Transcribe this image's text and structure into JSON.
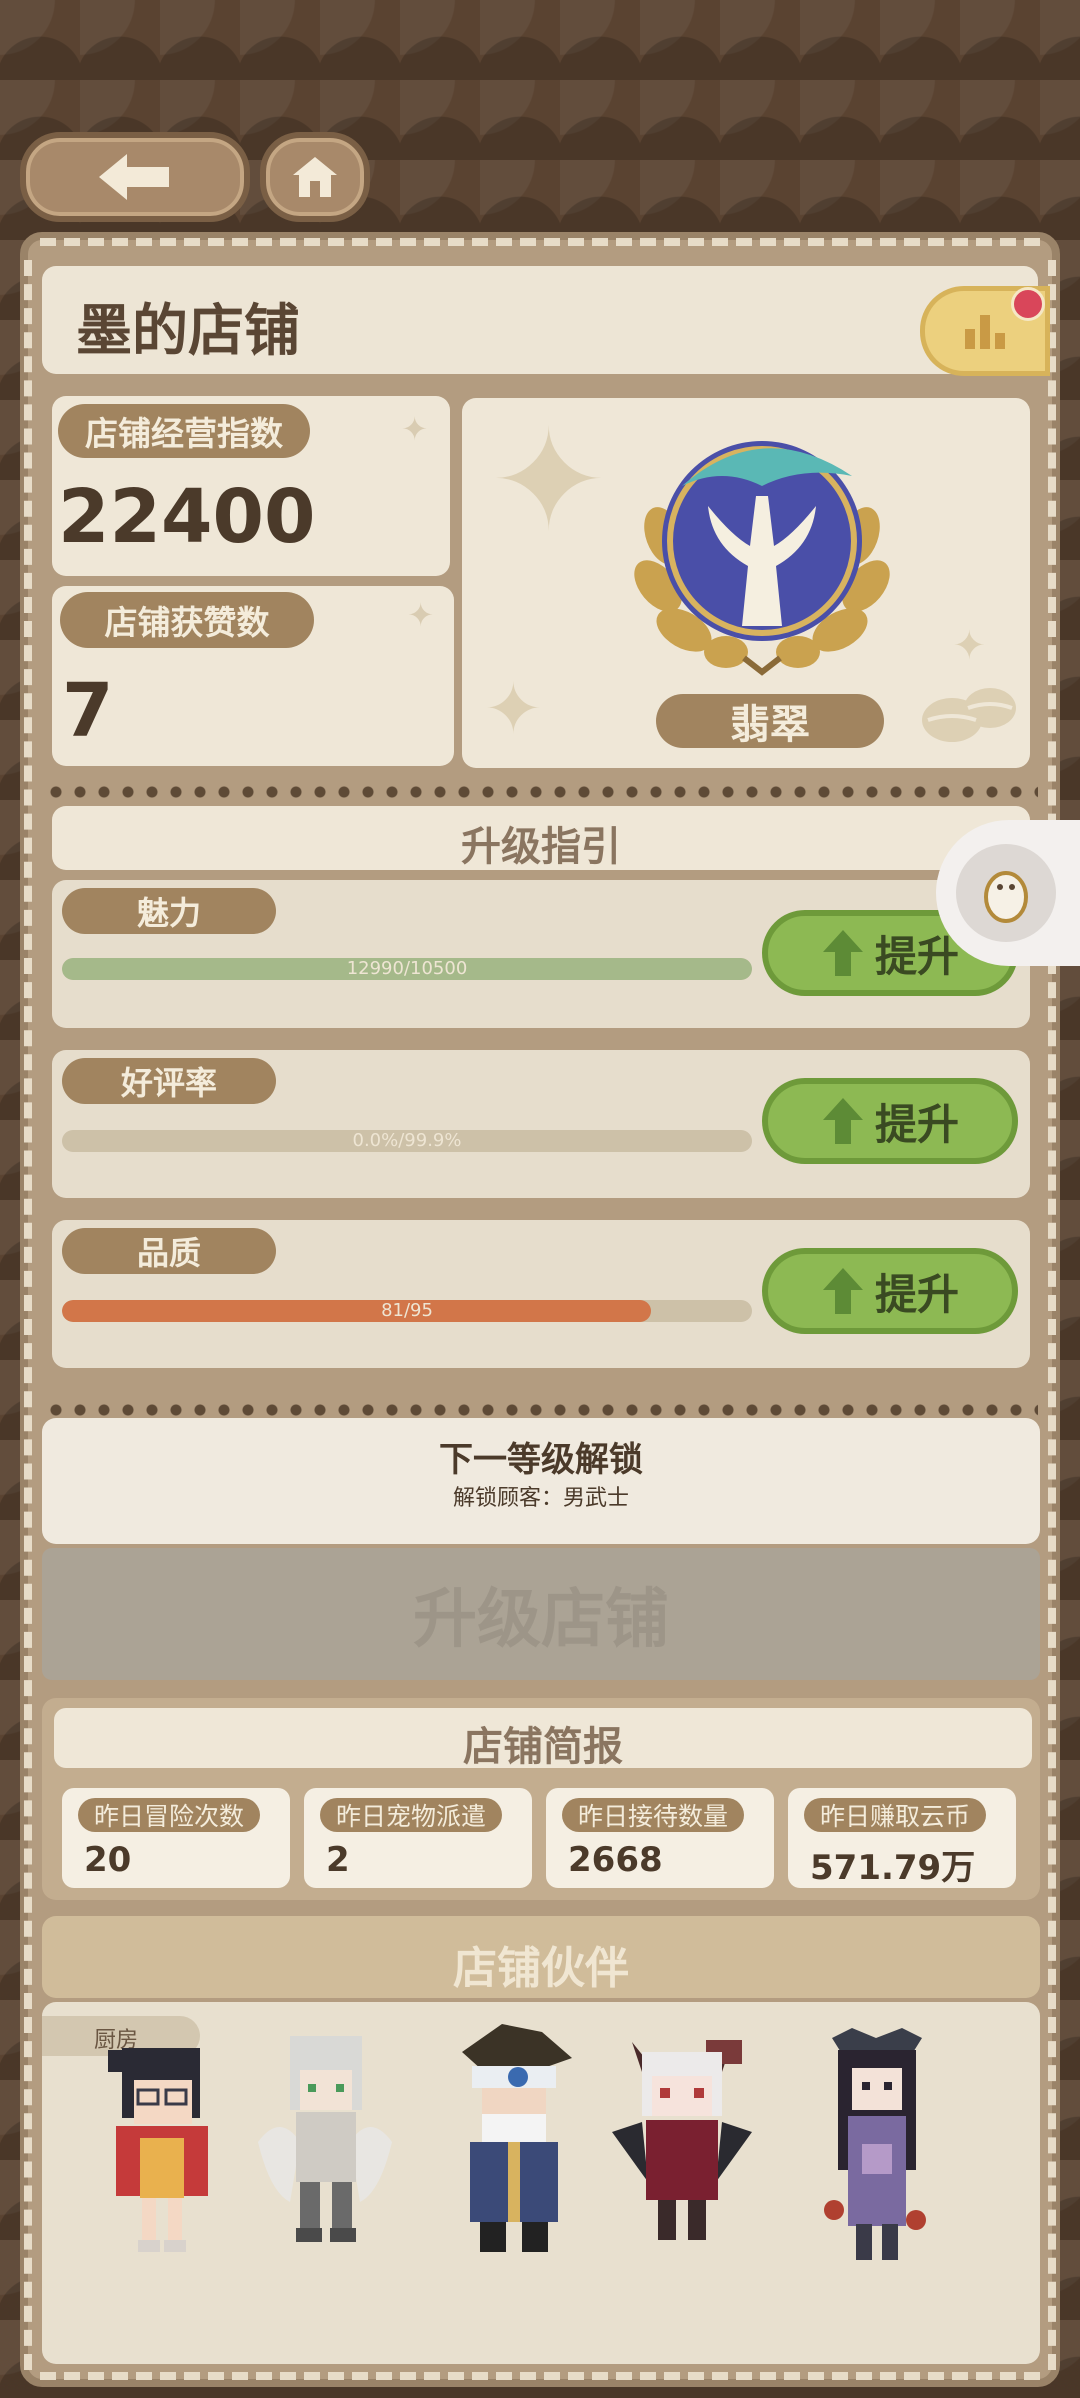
{
  "header": {
    "back_icon": "arrow-left-icon",
    "home_icon": "home-icon"
  },
  "shop": {
    "title": "墨的店铺",
    "rank_icon": "bar-chart-icon"
  },
  "stats": {
    "operation_label": "店铺经营指数",
    "operation_value": "22400",
    "likes_label": "店铺获赞数",
    "likes_value": "7",
    "badge_name": "翡翠"
  },
  "upgrade_guide": {
    "title": "升级指引",
    "items": [
      {
        "label": "魅力",
        "progress_text": "12990/10500",
        "progress": 1.0,
        "color": "#a5b98a",
        "button": "提升"
      },
      {
        "label": "好评率",
        "progress_text": "0.0%/99.9%",
        "progress": 0.0,
        "color": "#d0683e",
        "button": "提升"
      },
      {
        "label": "品质",
        "progress_text": "81/95",
        "progress": 0.853,
        "color": "#d27649",
        "button": "提升"
      }
    ]
  },
  "next_level": {
    "title": "下一等级解锁",
    "subtitle": "解锁顾客：男武士"
  },
  "upgrade_button": "升级店铺",
  "report": {
    "title": "店铺简报",
    "items": [
      {
        "label": "昨日冒险次数",
        "value": "20"
      },
      {
        "label": "昨日宠物派遣",
        "value": "2"
      },
      {
        "label": "昨日接待数量",
        "value": "2668"
      },
      {
        "label": "昨日赚取云币",
        "value": "571.79万"
      }
    ]
  },
  "partners": {
    "title": "店铺伙伴",
    "kitchen_tag": "厨房"
  },
  "colors": {
    "accent_green": "#8db953",
    "panel_beige": "#e6ddcc",
    "brown": "#a1845f"
  }
}
